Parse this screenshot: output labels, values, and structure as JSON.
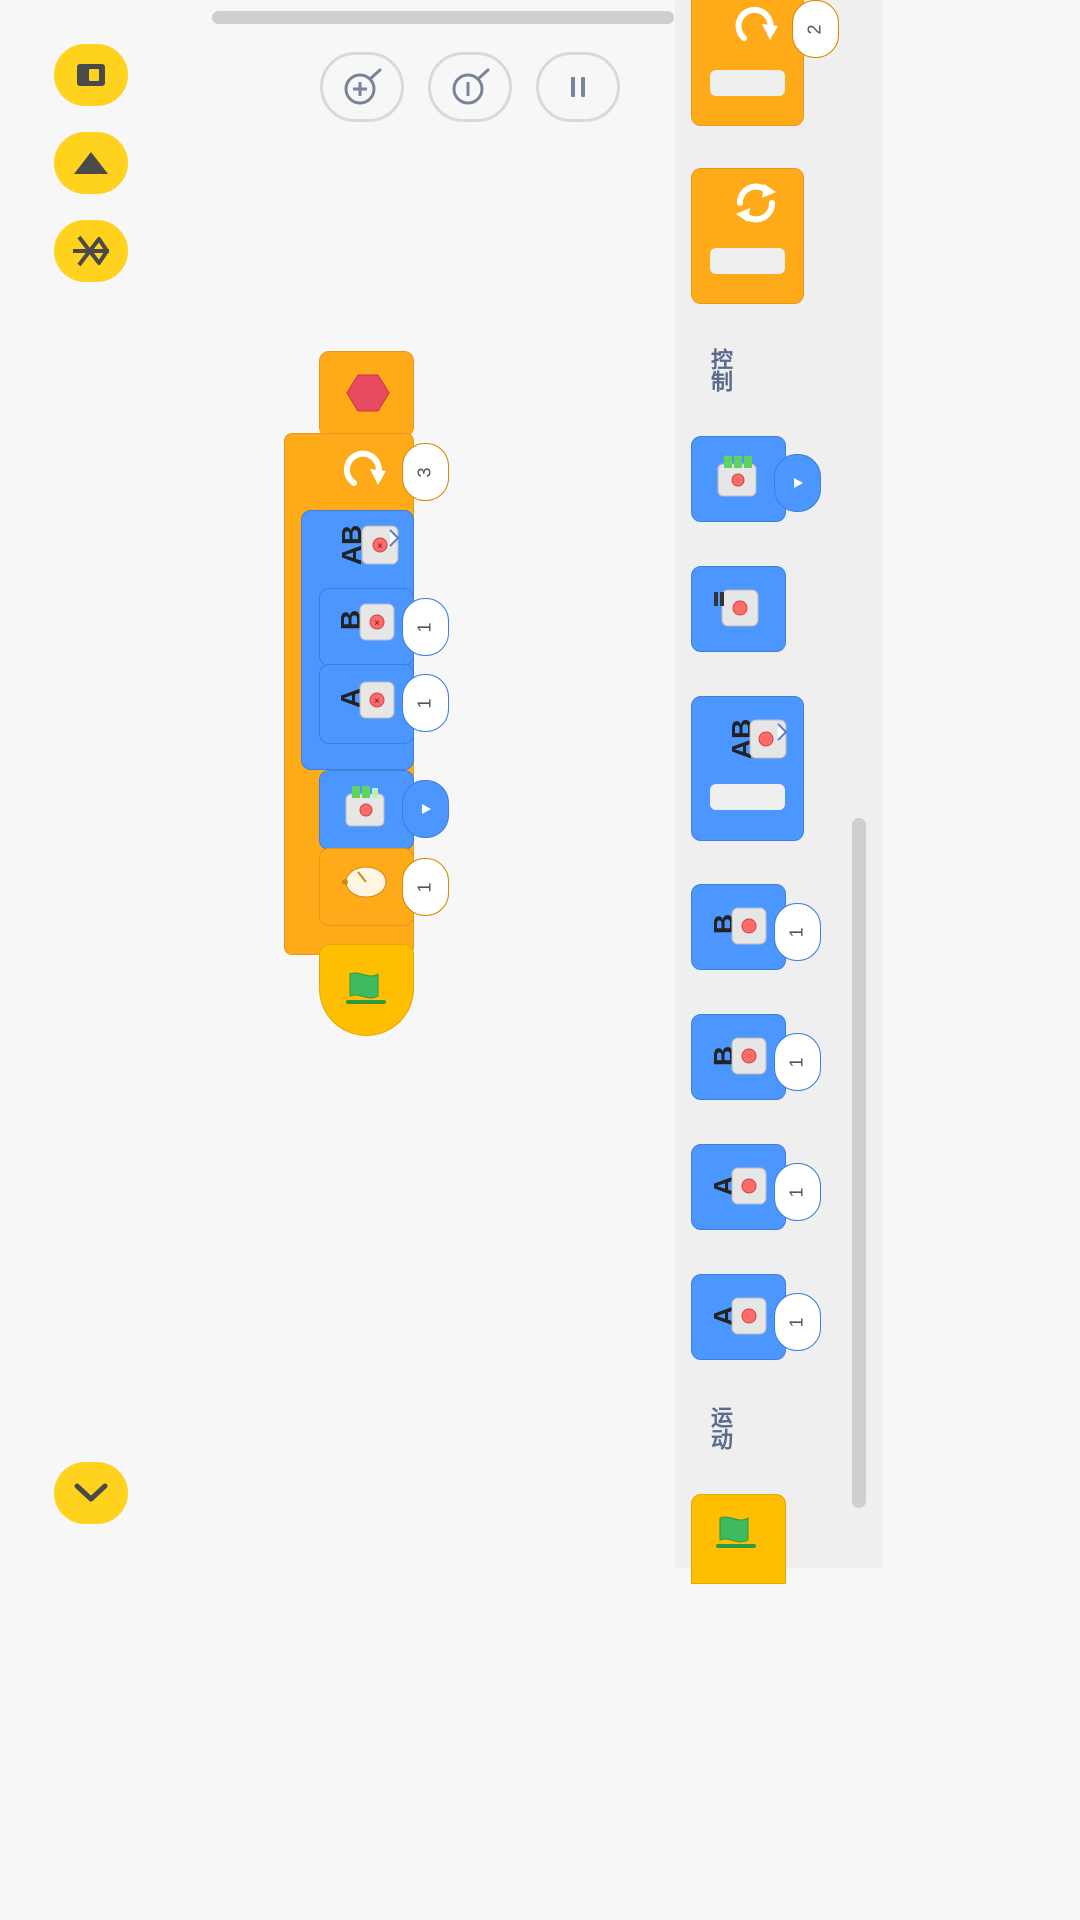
{
  "colors": {
    "block_blue": "#4c97ff",
    "block_orange": "#ffab19",
    "block_yellow": "#ffbf00",
    "fab_yellow": "#ffd21e"
  },
  "toolbar": {
    "left_buttons": [
      "exit-icon",
      "upload-icon",
      "bluetooth-icon"
    ],
    "collapse_button": "chevron-down-icon",
    "top_buttons": [
      "zoom-in-icon",
      "zoom-out-icon",
      "pause-icon"
    ]
  },
  "palette": {
    "categories": {
      "control": "控制",
      "motion": "运动"
    },
    "top_repeat_count": "2",
    "motion_values": [
      "1",
      "1",
      "1",
      "1"
    ],
    "light_block": "battery-light-icon"
  },
  "script": {
    "repeat_count": "3",
    "motor_b_value": "1",
    "motor_a_value": "1",
    "wait_value": "1",
    "motor_pair_label": "AB",
    "motor_b_label": "B",
    "motor_a_label": "A"
  }
}
